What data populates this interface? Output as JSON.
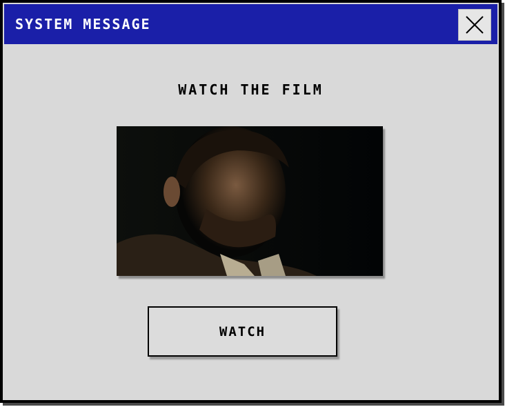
{
  "window": {
    "title": "SYSTEM MESSAGE",
    "close_icon": "close-x-icon"
  },
  "content": {
    "heading": "WATCH THE FILM",
    "thumbnail_subject": "film-still-thumbnail",
    "watch_label": "WATCH"
  },
  "colors": {
    "titlebar": "#1a1fa8",
    "window_bg": "#d9d9d9",
    "button_bg": "#dcdcdc",
    "title_text": "#ffffff"
  }
}
